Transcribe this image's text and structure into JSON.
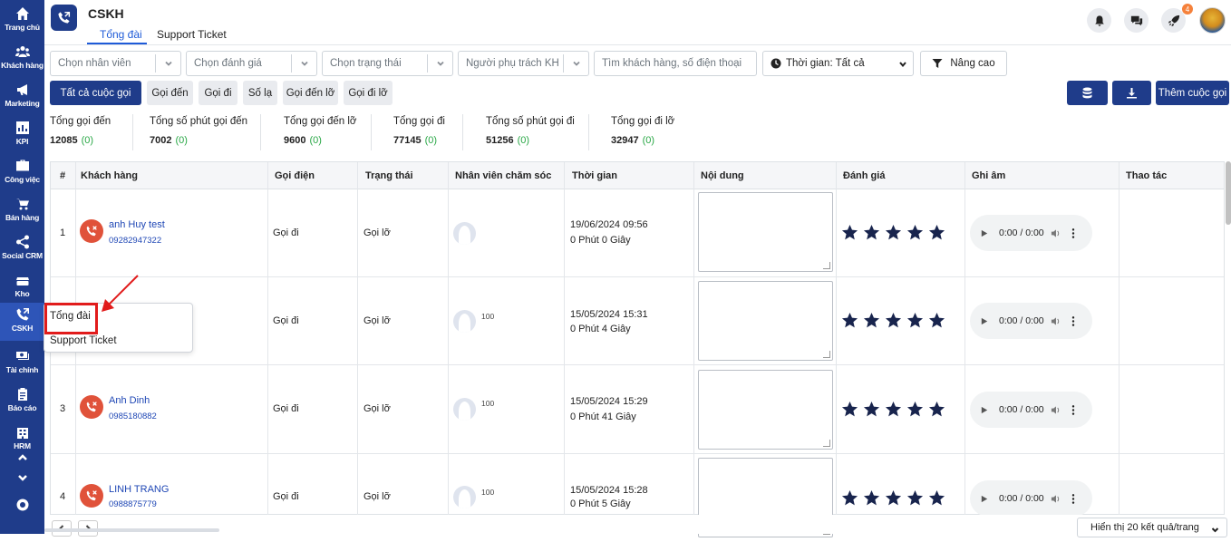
{
  "sidebar": {
    "items": [
      {
        "label": "Trang chủ",
        "icon": "home-icon"
      },
      {
        "label": "Khách hàng",
        "icon": "users-icon"
      },
      {
        "label": "Marketing",
        "icon": "megaphone-icon"
      },
      {
        "label": "KPI",
        "icon": "chart-icon"
      },
      {
        "label": "Công việc",
        "icon": "briefcase-icon"
      },
      {
        "label": "Bán hàng",
        "icon": "cart-icon"
      },
      {
        "label": "Social CRM",
        "icon": "share-icon"
      },
      {
        "label": "Kho",
        "icon": "warehouse-icon"
      },
      {
        "label": "CSKH",
        "icon": "phone-icon"
      },
      {
        "label": "Tài chính",
        "icon": "money-icon"
      },
      {
        "label": "Báo cáo",
        "icon": "clipboard-icon"
      },
      {
        "label": "HRM",
        "icon": "building-icon"
      }
    ]
  },
  "header": {
    "title": "CSKH",
    "tabs": [
      "Tổng đài",
      "Support Ticket"
    ],
    "notification_count": "4"
  },
  "filters": {
    "staff": "Chọn nhân viên",
    "rating": "Chọn đánh giá",
    "status": "Chọn trạng thái",
    "owner": "Người phụ trách KH",
    "search_placeholder": "Tìm khách hàng, số điện thoại",
    "time": "Thời gian: Tất cả",
    "advanced": "Nâng cao"
  },
  "quick_filters": [
    "Tất cả cuộc gọi",
    "Gọi đến",
    "Gọi đi",
    "Số lạ",
    "Gọi đến lỡ",
    "Gọi đi lỡ"
  ],
  "add_call_label": "Thêm cuộc gọi",
  "stats": [
    {
      "label": "Tổng gọi đến",
      "value": "12085",
      "delta": "(0)"
    },
    {
      "label": "Tổng số phút gọi đến",
      "value": "7002",
      "delta": "(0)"
    },
    {
      "label": "Tổng gọi đến lỡ",
      "value": "9600",
      "delta": "(0)"
    },
    {
      "label": "Tổng gọi đi",
      "value": "77145",
      "delta": "(0)"
    },
    {
      "label": "Tổng số phút gọi đi",
      "value": "51256",
      "delta": "(0)"
    },
    {
      "label": "Tổng gọi đi lỡ",
      "value": "32947",
      "delta": "(0)"
    }
  ],
  "table": {
    "columns": [
      "#",
      "Khách hàng",
      "Gọi điện",
      "Trạng thái",
      "Nhân viên chăm sóc",
      "Thời gian",
      "Nội dung",
      "Đánh giá",
      "Ghi âm",
      "Thao tác"
    ],
    "rows": [
      {
        "num": "1",
        "name": "anh Huy test",
        "phone": "09282947322",
        "call": "Gọi đi",
        "status": "Gọi lỡ",
        "staff": "",
        "date": "19/06/2024 09:56",
        "duration": "0 Phút 0 Giây",
        "rating": 5,
        "audio": "0:00 / 0:00"
      },
      {
        "num": "",
        "name": "",
        "phone": "",
        "call": "Gọi đi",
        "status": "Gọi lỡ",
        "staff": "100",
        "date": "15/05/2024 15:31",
        "duration": "0 Phút 4 Giây",
        "rating": 5,
        "audio": "0:00 / 0:00"
      },
      {
        "num": "3",
        "name": "Anh Dinh",
        "phone": "0985180882",
        "call": "Gọi đi",
        "status": "Gọi lỡ",
        "staff": "100",
        "date": "15/05/2024 15:29",
        "duration": "0 Phút 41 Giây",
        "rating": 5,
        "audio": "0:00 / 0:00"
      },
      {
        "num": "4",
        "name": "LINH TRANG",
        "phone": "0988875779",
        "call": "Gọi đi",
        "status": "Gọi lỡ",
        "staff": "100",
        "date": "15/05/2024 15:28",
        "duration": "0 Phút 5 Giây",
        "rating": 5,
        "audio": "0:00 / 0:00"
      }
    ]
  },
  "popup": {
    "item1": "Tổng đài",
    "item2": "Support Ticket"
  },
  "pagination": {
    "per_page": "Hiển thị 20 kết quả/trang"
  },
  "colors": {
    "sidebar": "#1f3c8a",
    "accent": "#1f5bd8",
    "missed_call": "#e0523a",
    "highlight": "#e11b1b",
    "delta": "#28a745"
  }
}
